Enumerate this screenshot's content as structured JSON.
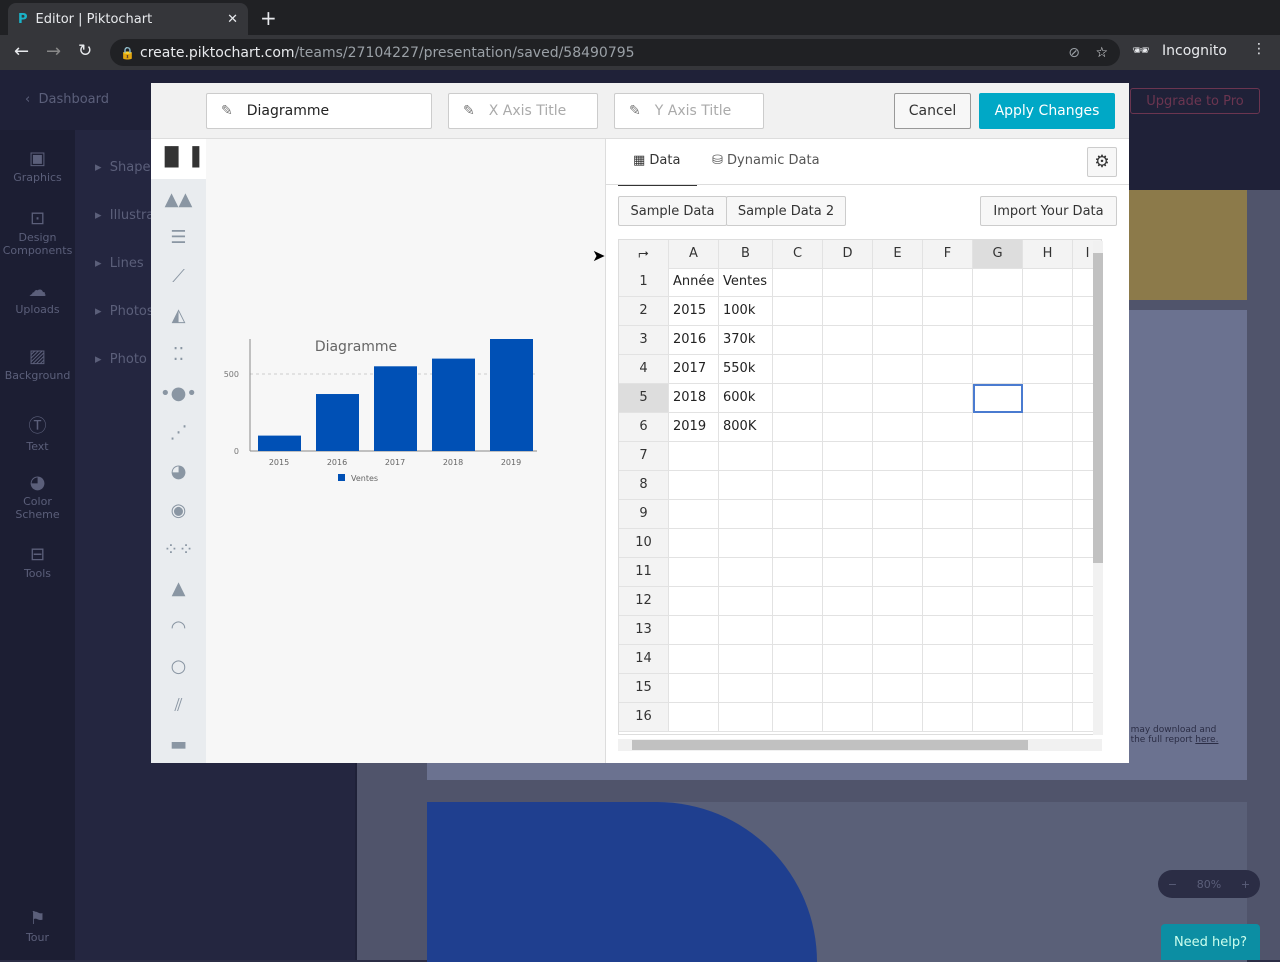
{
  "browser": {
    "tab_title": "Editor | Piktochart",
    "url_host": "create.piktochart.com",
    "url_path": "/teams/27104227/presentation/saved/58490795",
    "profile": "Incognito"
  },
  "app": {
    "back": "Dashboard",
    "upgrade": "Upgrade to Pro",
    "sidebar": [
      "Graphics",
      "Design Components",
      "Uploads",
      "Background",
      "Text",
      "Color Scheme",
      "Tools"
    ],
    "tour": "Tour",
    "flyout": [
      "Shapes",
      "Illustrations",
      "Lines",
      "Photos",
      "Photo"
    ],
    "zoom": "80%",
    "help": "Need help?",
    "canvas_text": [
      "u may download and",
      "d the full report ",
      "here."
    ]
  },
  "modal": {
    "chart_title": "Diagramme",
    "x_axis_placeholder": "X Axis Title",
    "y_axis_placeholder": "Y Axis Title",
    "cancel": "Cancel",
    "apply": "Apply Changes",
    "tabs": [
      "Data",
      "Dynamic Data"
    ],
    "sample1": "Sample Data",
    "sample2": "Sample Data 2",
    "import": "Import Your Data",
    "columns": [
      "A",
      "B",
      "C",
      "D",
      "E",
      "F",
      "G",
      "H",
      "I"
    ],
    "rows": [
      [
        "Année",
        "Ventes"
      ],
      [
        "2015",
        "100k"
      ],
      [
        "2016",
        "370k"
      ],
      [
        "2017",
        "550k"
      ],
      [
        "2018",
        "600k"
      ],
      [
        "2019",
        "800K"
      ],
      [],
      [],
      [],
      [],
      [],
      [],
      [],
      [],
      [],
      []
    ]
  },
  "colors": {
    "accent": "#00a8c6",
    "bar": "#0050b5"
  },
  "chart_data": {
    "type": "bar",
    "title": "Diagramme",
    "categories": [
      "2015",
      "2016",
      "2017",
      "2018",
      "2019"
    ],
    "series": [
      {
        "name": "Ventes",
        "values": [
          100,
          370,
          550,
          600,
          800
        ]
      }
    ],
    "yticks": [
      "0",
      "500"
    ],
    "ylim": [
      0,
      850
    ],
    "legend": "bottom"
  }
}
